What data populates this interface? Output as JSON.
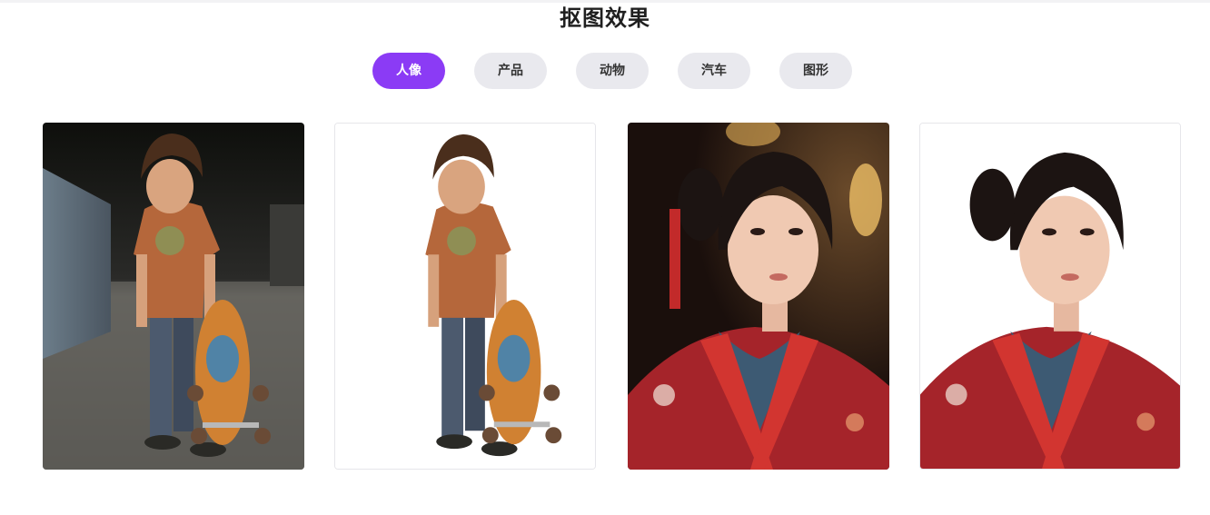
{
  "section": {
    "title": "抠图效果"
  },
  "tabs": [
    {
      "label": "人像",
      "active": true
    },
    {
      "label": "产品",
      "active": false
    },
    {
      "label": "动物",
      "active": false
    },
    {
      "label": "汽车",
      "active": false
    },
    {
      "label": "图形",
      "active": false
    }
  ],
  "colors": {
    "accent": "#8b3bf5",
    "tab_inactive": "#e9e9ee"
  },
  "gallery": [
    {
      "subject": "boy-with-skateboard",
      "variant": "original"
    },
    {
      "subject": "boy-with-skateboard",
      "variant": "cutout"
    },
    {
      "subject": "girl-in-red-kimono",
      "variant": "original"
    },
    {
      "subject": "girl-in-red-kimono",
      "variant": "cutout"
    }
  ]
}
